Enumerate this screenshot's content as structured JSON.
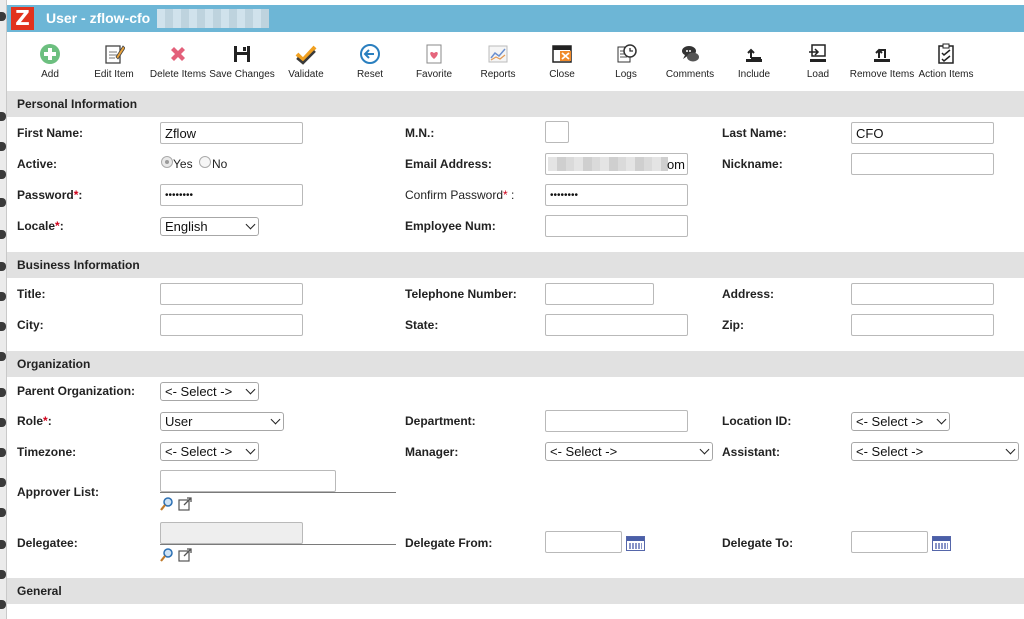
{
  "window": {
    "title": "User - zflow-cfo",
    "logo": "Z",
    "colors": {
      "titlebar": "#6db6d6",
      "logo": "#e2321d",
      "section": "#e1e1e1",
      "required": "#d0021b"
    }
  },
  "toolbar": {
    "items": [
      {
        "label": "Add",
        "icon": "add-icon"
      },
      {
        "label": "Edit Item",
        "icon": "edit-icon"
      },
      {
        "label": "Delete Items",
        "icon": "delete-icon"
      },
      {
        "label": "Save Changes",
        "icon": "save-icon"
      },
      {
        "label": "Validate",
        "icon": "checkmark-icon"
      },
      {
        "label": "Reset",
        "icon": "reset-icon"
      },
      {
        "label": "Favorite",
        "icon": "favorite-icon"
      },
      {
        "label": "Reports",
        "icon": "reports-icon"
      },
      {
        "label": "Close",
        "icon": "close-icon"
      },
      {
        "label": "Logs",
        "icon": "logs-icon"
      },
      {
        "label": "Comments",
        "icon": "comments-icon"
      },
      {
        "label": "Include",
        "icon": "include-icon"
      },
      {
        "label": "Load",
        "icon": "load-icon"
      },
      {
        "label": "Remove Items",
        "icon": "remove-items-icon"
      },
      {
        "label": "Action Items",
        "icon": "action-items-icon"
      }
    ]
  },
  "personal": {
    "header": "Personal Information",
    "first_name": {
      "label": "First Name:",
      "value": "Zflow"
    },
    "mn": {
      "label": "M.N.:",
      "value": ""
    },
    "last_name": {
      "label": "Last Name:",
      "value": "CFO"
    },
    "active": {
      "label": "Active:",
      "yes": "Yes",
      "no": "No",
      "selected": "Yes"
    },
    "email": {
      "label": "Email Address:",
      "value_suffix": "om"
    },
    "nickname": {
      "label": "Nickname:",
      "value": ""
    },
    "password": {
      "label": "Password",
      "req": "*",
      "colon": ":",
      "value": "••••••••"
    },
    "confirm_password": {
      "label": "Confirm Password",
      "req": "*",
      "colon": " :",
      "value": "••••••••"
    },
    "locale": {
      "label": "Locale",
      "req": "*",
      "colon": ":",
      "value": "English"
    },
    "employee_num": {
      "label": "Employee Num:",
      "value": ""
    }
  },
  "business": {
    "header": "Business Information",
    "title": {
      "label": "Title:",
      "value": ""
    },
    "telephone": {
      "label": "Telephone Number:",
      "value": ""
    },
    "address": {
      "label": "Address:",
      "value": ""
    },
    "city": {
      "label": "City:",
      "value": ""
    },
    "state": {
      "label": "State:",
      "value": ""
    },
    "zip": {
      "label": "Zip:",
      "value": ""
    }
  },
  "organization": {
    "header": "Organization",
    "parent_org": {
      "label": "Parent Organization:",
      "value": "<- Select ->"
    },
    "role": {
      "label": "Role",
      "req": "*",
      "colon": ":",
      "value": "User"
    },
    "department": {
      "label": "Department:",
      "value": ""
    },
    "location_id": {
      "label": "Location ID:",
      "value": "<- Select ->"
    },
    "timezone": {
      "label": "Timezone:",
      "value": "<- Select ->"
    },
    "manager": {
      "label": "Manager:",
      "value": "<- Select ->"
    },
    "assistant": {
      "label": "Assistant:",
      "value": "<- Select ->"
    },
    "approver_list": {
      "label": "Approver List:",
      "value": ""
    },
    "delegatee": {
      "label": "Delegatee:",
      "value": ""
    },
    "delegate_from": {
      "label": "Delegate From:",
      "value": ""
    },
    "delegate_to": {
      "label": "Delegate To:",
      "value": ""
    }
  },
  "general": {
    "header": "General"
  }
}
